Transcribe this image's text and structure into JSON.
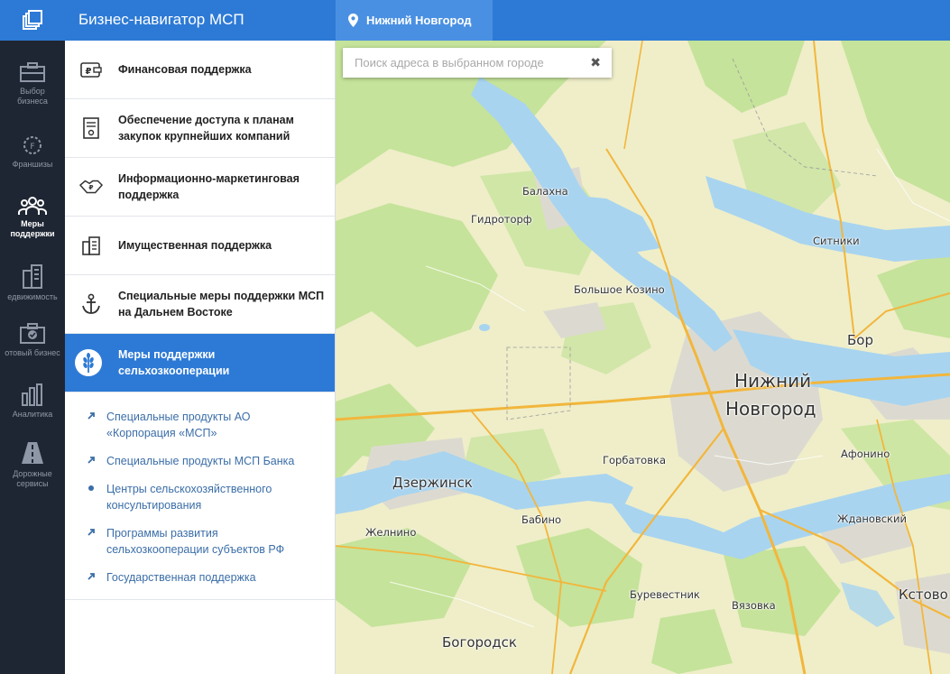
{
  "header": {
    "title": "Бизнес-навигатор МСП",
    "city": "Нижний Новгород"
  },
  "rail": {
    "items": [
      {
        "label1": "Выбор",
        "label2": "бизнеса"
      },
      {
        "label1": "Франшизы",
        "label2": ""
      },
      {
        "label1": "Меры",
        "label2": "поддержки"
      },
      {
        "label1": "едвижимость",
        "label2": ""
      },
      {
        "label1": "отовый бизнес",
        "label2": ""
      },
      {
        "label1": "Аналитика",
        "label2": ""
      },
      {
        "label1": "Дорожные",
        "label2": "сервисы"
      }
    ]
  },
  "panel": {
    "categories": [
      {
        "label": "Финансовая поддержка"
      },
      {
        "label": "Обеспечение доступа к планам закупок крупнейших компаний"
      },
      {
        "label": "Информационно-маркетинговая поддержка"
      },
      {
        "label": "Имущественная поддержка"
      },
      {
        "label": "Специальные меры поддержки МСП на Дальнем Востоке"
      },
      {
        "label": "Меры поддержки сельхозкооперации"
      }
    ],
    "subitems": [
      {
        "label": "Специальные продукты АО «Корпорация «МСП»"
      },
      {
        "label": "Специальные продукты МСП Банка"
      },
      {
        "label": "Центры сельскохозяйственного консультирования"
      },
      {
        "label": "Программы развития сельхозкооперации субъектов РФ"
      },
      {
        "label": "Государственная поддержка"
      }
    ]
  },
  "map": {
    "search_placeholder": "Поиск адреса в выбранном городе",
    "clear_glyph": "✖",
    "labels": {
      "balakhna": "Балахна",
      "gidrotorf": "Гидроторф",
      "sitniki": "Ситники",
      "bolshoe_kozino": "Большое Козино",
      "bor": "Бор",
      "nn1": "Нижний",
      "nn2": "Новгород",
      "afonino": "Афонино",
      "gorbatovka": "Горбатовка",
      "dzerzhinsk": "Дзержинск",
      "babino": "Бабино",
      "zhdanovsky": "Ждановский",
      "zhelnino": "Желнино",
      "burevestnik": "Буревестник",
      "vyazovka": "Вязовка",
      "kstovo": "Кстово",
      "bogorodsk": "Богородск"
    }
  },
  "colors": {
    "primary": "#2d7ad6",
    "rail_bg": "#1f2633",
    "link": "#3b6ea8",
    "map_land": "#efeec9",
    "map_forest": "#c5e39a",
    "map_water": "#a8d4f0",
    "map_road": "#f2b63c"
  }
}
